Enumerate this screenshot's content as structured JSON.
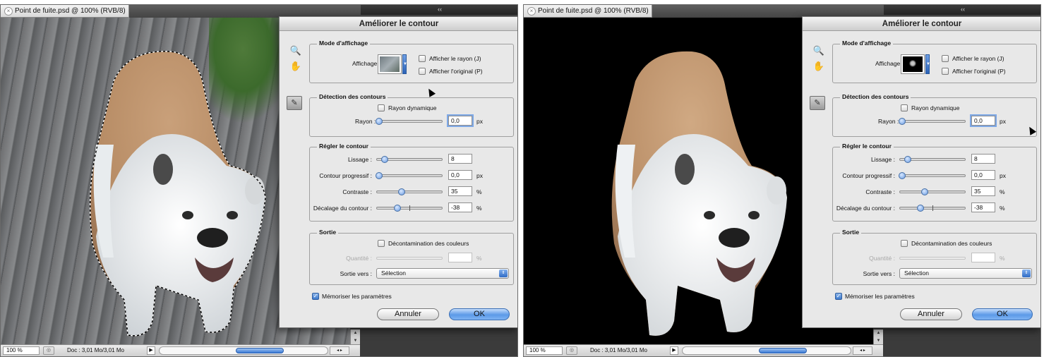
{
  "document": {
    "title": "Point de fuite.psd @ 100% (RVB/8)",
    "close_glyph": "×",
    "collapse_glyph": "‹‹"
  },
  "statusbar": {
    "zoom": "100 %",
    "doc_size": "Doc : 3,01 Mo/3,01 Mo",
    "play_glyph": "▶",
    "scroll_arrows": "◂ ▸",
    "vscroll_up": "▲",
    "vscroll_down": "▼"
  },
  "dialog": {
    "title": "Améliorer le contour",
    "tools": {
      "zoom_icon": "🔍",
      "hand_icon": "✋",
      "refine_icon": "✎"
    },
    "view_mode": {
      "title": "Mode d'affichage",
      "view_label": "Affichage :",
      "show_radius_label": "Afficher le rayon (J)",
      "show_original_label": "Afficher l'original (P)",
      "show_radius_checked": false,
      "show_original_checked": false
    },
    "edge_detection": {
      "title": "Détection des contours",
      "smart_radius_label": "Rayon dynamique",
      "smart_radius_checked": false,
      "radius_label": "Rayon :",
      "radius_value": "0,0",
      "radius_unit": "px"
    },
    "adjust_edge": {
      "title": "Régler le contour",
      "smooth_label": "Lissage :",
      "smooth_value": "8",
      "feather_label": "Contour progressif :",
      "feather_value": "0,0",
      "feather_unit": "px",
      "contrast_label": "Contraste :",
      "contrast_value": "35",
      "contrast_unit": "%",
      "shift_label": "Décalage du contour :",
      "shift_value": "-38",
      "shift_unit": "%"
    },
    "output": {
      "title": "Sortie",
      "decontaminate_label": "Décontamination des couleurs",
      "decontaminate_checked": false,
      "amount_label": "Quantité :",
      "amount_value": "",
      "amount_unit": "%",
      "output_to_label": "Sortie vers :",
      "output_to_value": "Sélection",
      "select_arrow": "⇕"
    },
    "remember_label": "Mémoriser les paramètres",
    "remember_checked": true,
    "checkmark": "✓",
    "cancel_label": "Annuler",
    "ok_label": "OK"
  },
  "left_pane": {
    "view_mode": "Sélection animée",
    "colors": {
      "background": "#7a7c7e",
      "selection": "#ffffff"
    }
  },
  "right_pane": {
    "view_mode": "Sur fond noir",
    "colors": {
      "background": "#000000"
    }
  },
  "colors": {
    "accent_blue": "#3c79cd",
    "dialog_bg": "#e8e8e8",
    "workspace_bg": "#3b3b3b"
  }
}
